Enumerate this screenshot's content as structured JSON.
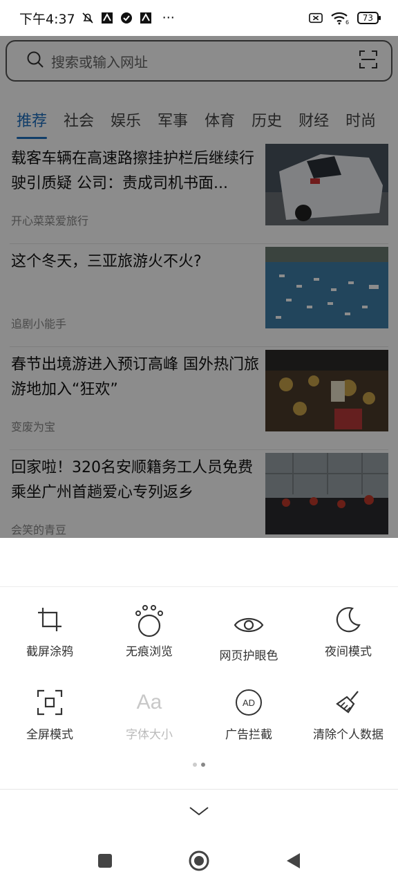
{
  "status_bar": {
    "time": "下午4:37",
    "battery": "73",
    "signal_sub": "6",
    "menu_more": "···"
  },
  "search": {
    "placeholder": "搜索或输入网址"
  },
  "tabs": [
    {
      "label": "推荐",
      "active": true
    },
    {
      "label": "社会"
    },
    {
      "label": "娱乐"
    },
    {
      "label": "军事"
    },
    {
      "label": "体育"
    },
    {
      "label": "历史"
    },
    {
      "label": "财经"
    },
    {
      "label": "时尚"
    }
  ],
  "news": [
    {
      "title": "载客车辆在高速路擦挂护栏后继续行驶引质疑 公司：责成司机书面...",
      "source": "开心菜菜爱旅行"
    },
    {
      "title": "这个冬天，三亚旅游火不火?",
      "source": "追剧小能手"
    },
    {
      "title": "春节出境游进入预订高峰 国外热门旅游地加入“狂欢”",
      "source": "变废为宝"
    },
    {
      "title": "回家啦！320名安顺籍务工人员免费乘坐广州首趟爱心专列返乡",
      "source": "会笑的青豆"
    }
  ],
  "tools": [
    {
      "label": "截屏涂鸦",
      "icon": "crop-icon"
    },
    {
      "label": "无痕浏览",
      "icon": "paw-icon"
    },
    {
      "label": "网页护眼色",
      "icon": "eye-icon"
    },
    {
      "label": "夜间模式",
      "icon": "moon-icon"
    },
    {
      "label": "全屏模式",
      "icon": "fullscreen-icon"
    },
    {
      "label": "字体大小",
      "icon": "font-size-icon",
      "disabled": true,
      "glyph": "Aa"
    },
    {
      "label": "广告拦截",
      "icon": "ad-block-icon",
      "glyph": "AD"
    },
    {
      "label": "清除个人数据",
      "icon": "broom-icon"
    }
  ],
  "pager": {
    "pages": 2,
    "current": 2
  },
  "colors": {
    "accent": "#1e6fbf",
    "overlay": "rgba(0,0,0,0.45)"
  }
}
